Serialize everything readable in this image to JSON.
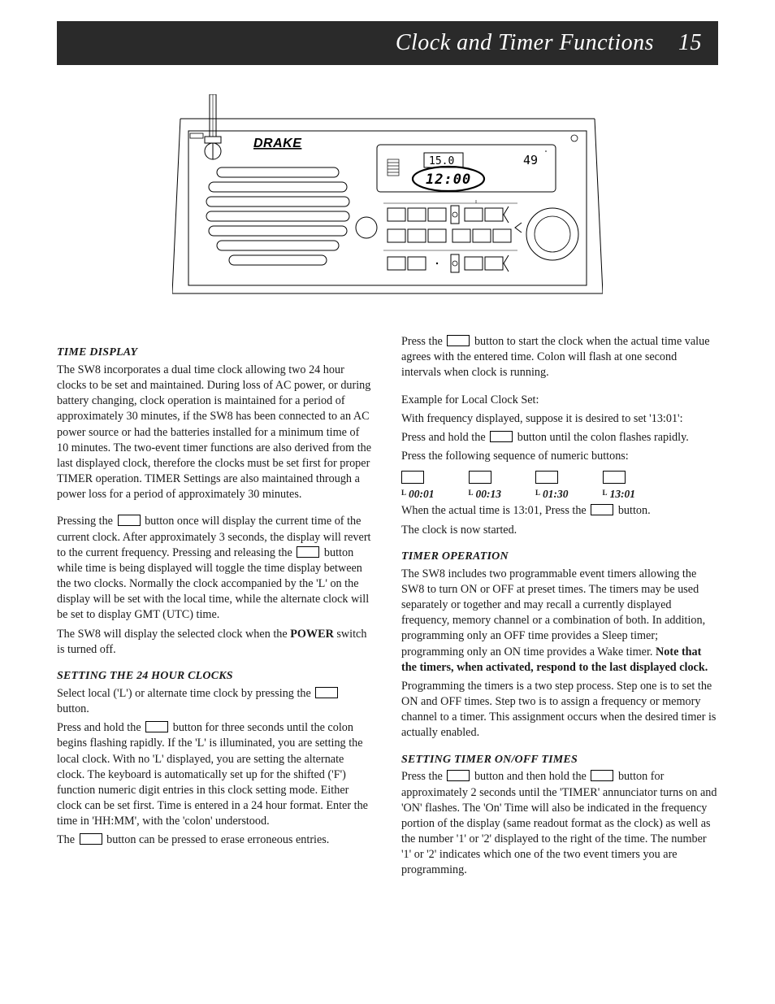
{
  "header": {
    "title": "Clock and Timer Functions",
    "page_number": "15"
  },
  "illustration": {
    "brand": "DRAKE",
    "freq1": "15.0",
    "freq2": "49",
    "clock": "12:00"
  },
  "left": {
    "s1_head": "TIME DISPLAY",
    "s1_p1": "The SW8 incorporates a dual time clock allowing two 24 hour clocks to be set and maintained.  During loss of AC power, or during battery changing, clock operation is maintained for a period of approximately 30 minutes, if the SW8 has been connected to an AC power source or had the batteries installed for a minimum time of 10 minutes.  The two-event timer functions are also derived from the last displayed clock, therefore the clocks must be set first for proper TIMER operation.  TIMER Settings are also maintained through a power loss for a period of approximately 30 minutes.",
    "s1_p2a": "Pressing the ",
    "s1_p2b": " button once will display the current time of the current clock.  After approximately 3 seconds, the display will revert to the current frequency.  Pressing and releasing the ",
    "s1_p2c": " button while time is being displayed will toggle the time display between the two clocks.  Normally the clock accompanied by the 'L' on the display will be set with the local time, while the alternate clock will be set to display GMT (UTC) time.",
    "s1_p3a": "The SW8 will display the selected clock when the ",
    "s1_p3_power": "POWER",
    "s1_p3b": " switch is turned off.",
    "s2_head": "SETTING THE 24 HOUR CLOCKS",
    "s2_p1a": "Select local ('L') or alternate time clock by pressing the ",
    "s2_p1b": " button.",
    "s2_p2a": "Press and hold the ",
    "s2_p2b": " button for three seconds until the colon begins flashing rapidly.  If the 'L' is illuminated, you are setting the local clock.  With no 'L' displayed, you are setting the alternate clock.  The keyboard is automatically set up for the shifted ('F') function numeric digit entries in this clock setting mode. Either clock can be set first.  Time is entered in a 24 hour format.  Enter the time in 'HH:MM', with the 'colon' understood.",
    "s2_p3a": "The ",
    "s2_p3b": " button can be pressed to erase erroneous entries."
  },
  "right": {
    "r1a": "Press the ",
    "r1b": " button to start the clock when the actual time value agrees with the entered time.  Colon will flash at one second intervals when clock is running.",
    "r2": "Example for Local Clock Set:",
    "r3": "With frequency displayed, suppose it is desired to set '13:01':",
    "r4a": "Press and hold the ",
    "r4b": " button until the colon flashes rapidly.",
    "r5": "Press the following sequence of numeric buttons:",
    "seq": [
      "00:01",
      "00:13",
      "01:30",
      "13:01"
    ],
    "r6a": "When the actual time is 13:01, Press the ",
    "r6b": " button.",
    "r7": "The clock is now started.",
    "s3_head": "TIMER OPERATION",
    "s3_p1": "The SW8 includes two programmable event timers allowing the SW8 to turn ON or OFF at preset times.  The timers may be used separately or together and may recall a currently displayed frequency, memory channel or a combination of both.  In addition, programming only an OFF time provides a Sleep timer; programming only an ON time provides a Wake timer.  ",
    "s3_note": "Note that the timers, when activated, respond to the last displayed clock.",
    "s3_p2": "Programming the timers is a two step process.  Step one is to set the ON and OFF times.  Step two is to assign a frequency or memory channel to a timer.  This assignment occurs when the desired timer is actually enabled.",
    "s4_head": "SETTING TIMER ON/OFF TIMES",
    "s4_p1a": "Press the ",
    "s4_p1b": " button and then hold the ",
    "s4_p1c": " button for approximately 2 seconds until the 'TIMER' annunciator turns on and 'ON' flashes.   The 'On' Time will also be indicated in the frequency portion of the display (same readout format as the clock) as well as the number '1' or '2' displayed to the right of the time.  The number '1' or '2' indicates which one of the two event timers you are programming."
  }
}
